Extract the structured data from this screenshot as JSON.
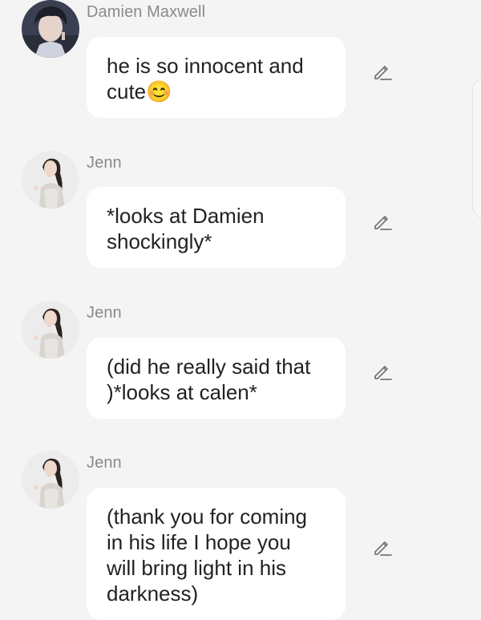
{
  "messages": [
    {
      "sender": "Damien Maxwell",
      "text": "he is so innocent and cute😊",
      "avatar": "male-avatar",
      "edit_icon": "pencil-icon"
    },
    {
      "sender": "Jenn",
      "text": "*looks at Damien shockingly*",
      "avatar": "female-avatar",
      "edit_icon": "pencil-icon"
    },
    {
      "sender": "Jenn",
      "text": "(did he really said that )*looks at calen*",
      "avatar": "female-avatar",
      "edit_icon": "pencil-icon"
    },
    {
      "sender": "Jenn",
      "text": "(thank you for coming in his life I hope you will bring light in his darkness)",
      "avatar": "female-avatar",
      "edit_icon": "pencil-icon"
    }
  ],
  "colors": {
    "background": "#f4f4f4",
    "bubble": "#ffffff",
    "name_text": "#8a8a8a",
    "message_text": "#222222",
    "edit_icon": "#777777"
  }
}
